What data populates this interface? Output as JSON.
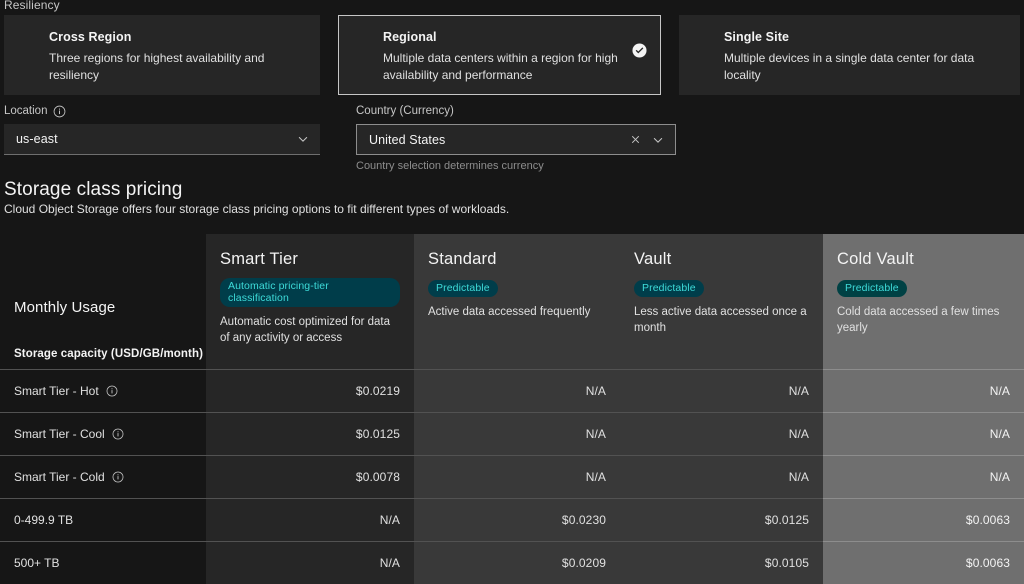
{
  "resiliency": {
    "label": "Resiliency",
    "options": [
      {
        "title": "Cross Region",
        "desc": "Three regions for highest availability and resiliency",
        "selected": false
      },
      {
        "title": "Regional",
        "desc": "Multiple data centers within a region for high availability and performance",
        "selected": true
      },
      {
        "title": "Single Site",
        "desc": "Multiple devices in a single data center for data locality",
        "selected": false
      }
    ],
    "selected_icon": "check-circle-filled-icon"
  },
  "form": {
    "location": {
      "label": "Location",
      "info_icon": "information-icon",
      "value": "us-east",
      "chevron_icon": "chevron-down-icon"
    },
    "country": {
      "label": "Country (Currency)",
      "value": "United States",
      "clear_icon": "close-icon",
      "chevron_icon": "chevron-down-icon",
      "helper": "Country selection determines currency"
    }
  },
  "pricing_section": {
    "heading": "Storage class pricing",
    "subheading": "Cloud Object Storage offers four storage class pricing options to fit different types of workloads."
  },
  "table": {
    "usage_header": "Monthly Usage",
    "section_title": "Storage capacity (USD/GB/month)",
    "columns": [
      {
        "name": "Smart Tier",
        "tag": "Automatic pricing-tier classification",
        "desc": "Automatic cost optimized for data of any activity or access",
        "highlighted": false
      },
      {
        "name": "Standard",
        "tag": "Predictable",
        "desc": "Active data accessed frequently",
        "highlighted": false
      },
      {
        "name": "Vault",
        "tag": "Predictable",
        "desc": "Less active data accessed once a month",
        "highlighted": false
      },
      {
        "name": "Cold Vault",
        "tag": "Predictable",
        "desc": "Cold data accessed a few times yearly",
        "highlighted": true
      }
    ],
    "rows": [
      {
        "label": "Smart Tier - Hot",
        "info_icon": "information-icon",
        "has_info": true,
        "values": [
          "$0.0219",
          "N/A",
          "N/A",
          "N/A"
        ]
      },
      {
        "label": "Smart Tier - Cool",
        "info_icon": "information-icon",
        "has_info": true,
        "values": [
          "$0.0125",
          "N/A",
          "N/A",
          "N/A"
        ]
      },
      {
        "label": "Smart Tier - Cold",
        "info_icon": "information-icon",
        "has_info": true,
        "values": [
          "$0.0078",
          "N/A",
          "N/A",
          "N/A"
        ]
      },
      {
        "label": "0-499.9 TB",
        "info_icon": "",
        "has_info": false,
        "values": [
          "N/A",
          "$0.0230",
          "$0.0125",
          "$0.0063"
        ]
      },
      {
        "label": "500+ TB",
        "info_icon": "",
        "has_info": false,
        "values": [
          "N/A",
          "$0.0209",
          "$0.0105",
          "$0.0063"
        ]
      }
    ]
  },
  "colors": {
    "page_bg": "#161616",
    "tile_bg": "#262626",
    "col_standard_bg": "#393939",
    "col_cold_highlight_bg": "#6f6f6f",
    "tag_bg": "#003d4a",
    "tag_text": "#3ddbd9",
    "selected_border": "#c6c6c6"
  }
}
